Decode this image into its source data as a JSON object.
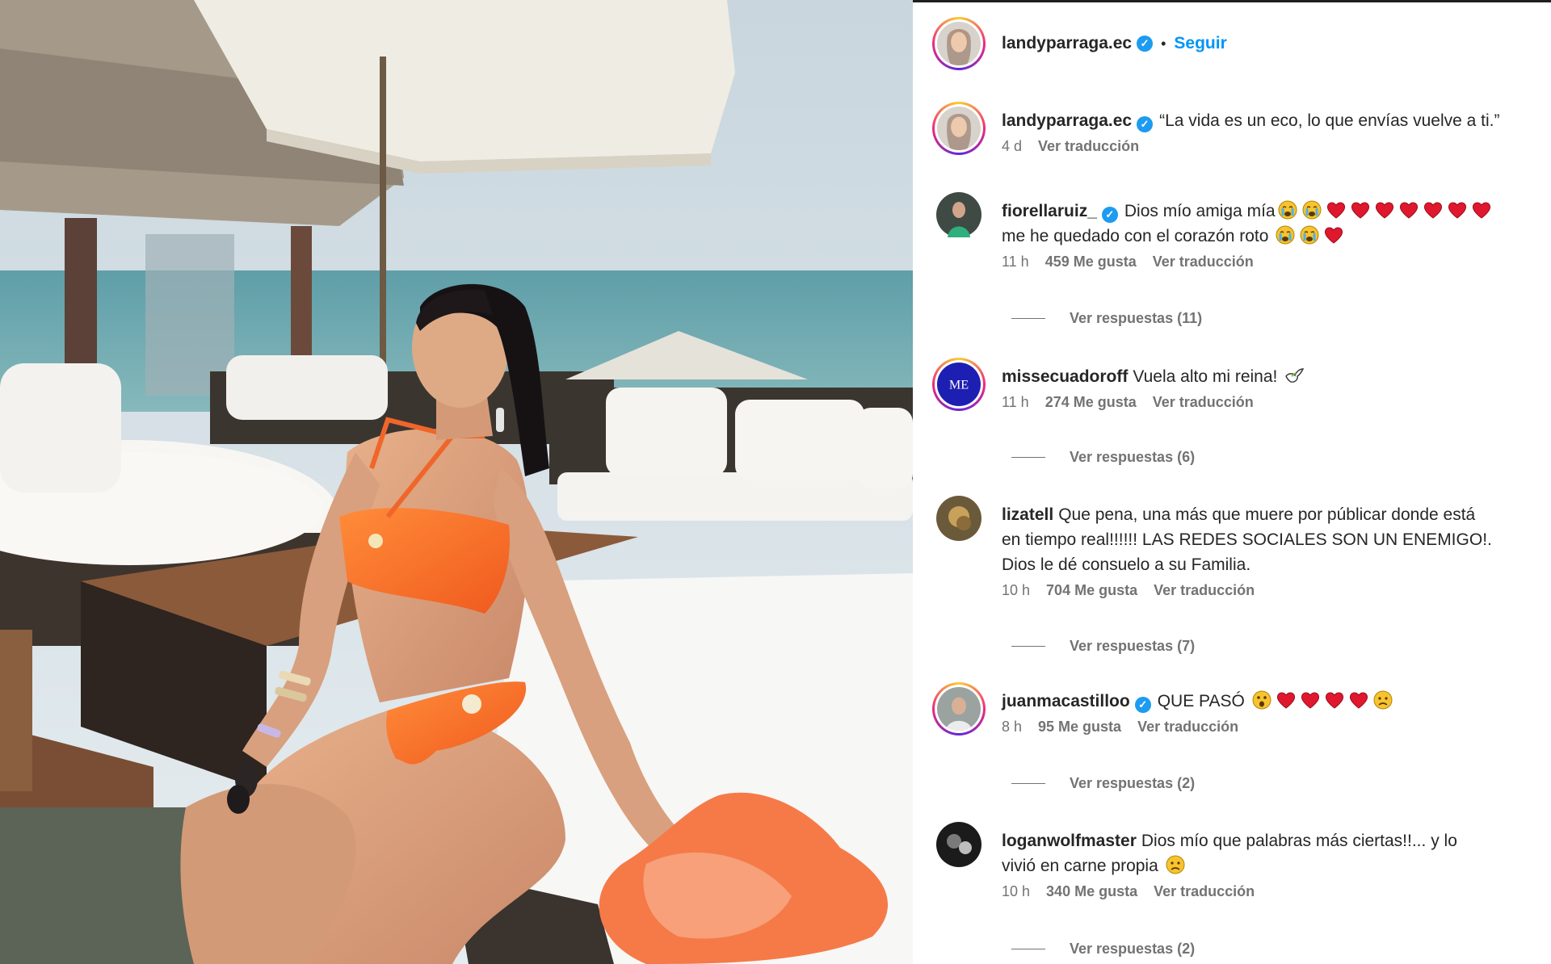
{
  "post": {
    "username": "landyparraga.ec",
    "separator": "•",
    "follow_label": "Seguir",
    "caption": "“La vida es un eco, lo que envías vuelve a ti.”",
    "caption_time": "4 d",
    "caption_translate": "Ver traducción",
    "verified_glyph": "✓"
  },
  "comments": [
    {
      "username": "fiorellaruiz_",
      "verified": true,
      "line1": "Dios mío amiga mía",
      "line1_emoji": [
        "crying-face",
        "crying-face",
        "red-heart",
        "red-heart",
        "red-heart",
        "red-heart",
        "red-heart",
        "red-heart",
        "red-heart"
      ],
      "line2": "me he quedado con el corazón roto",
      "line2_emoji": [
        "crying-face",
        "crying-face",
        "red-heart"
      ],
      "time": "11 h",
      "likes": "459 Me gusta",
      "translate": "Ver traducción",
      "replies": "Ver respuestas (11)"
    },
    {
      "username": "missecuadoroff",
      "verified": false,
      "line1": "Vuela alto mi reina!",
      "line1_emoji": [
        "dove"
      ],
      "time": "11 h",
      "likes": "274 Me gusta",
      "translate": "Ver traducción",
      "replies": "Ver respuestas (6)",
      "avatar_text": "ME"
    },
    {
      "username": "lizatell",
      "verified": false,
      "line1": "Que pena, una más que muere por públicar donde está",
      "line2": "en tiempo real!!!!!! LAS REDES SOCIALES SON UN ENEMIGO!.",
      "line3": "Dios le dé consuelo a su Familia.",
      "time": "10 h",
      "likes": "704 Me gusta",
      "translate": "Ver traducción",
      "replies": "Ver respuestas (7)"
    },
    {
      "username": "juanmacastilloo",
      "verified": true,
      "line1": "QUE PASÓ",
      "line1_emoji": [
        "astonished-face",
        "red-heart",
        "red-heart",
        "red-heart",
        "red-heart",
        "sad-face"
      ],
      "time": "8 h",
      "likes": "95 Me gusta",
      "translate": "Ver traducción",
      "replies": "Ver respuestas (2)"
    },
    {
      "username": "loganwolfmaster",
      "verified": false,
      "line1": "Dios mío que palabras más ciertas!!... y lo",
      "line2": "vivió en carne propia",
      "line2_emoji": [
        "sad-face"
      ],
      "time": "10 h",
      "likes": "340 Me gusta",
      "translate": "Ver traducción",
      "replies": "Ver respuestas (2)"
    }
  ],
  "colors": {
    "link": "#0095f6",
    "meta": "#737373",
    "text": "#262626",
    "verified": "#1d9bf0"
  }
}
